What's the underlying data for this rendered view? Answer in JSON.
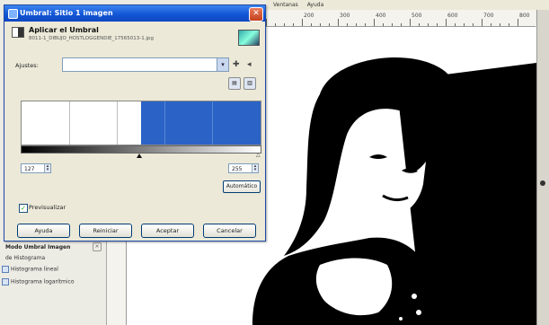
{
  "dialog": {
    "title": "Umbral: Sitio 1 imagen",
    "header_title": "Aplicar el Umbral",
    "header_file": "8011-1_DIBUJO_HOSTLOGGENDIE_17565013-1.jpg",
    "presets_label": "Ajustes:",
    "presets_value": "",
    "low_value": "127",
    "high_value": "255",
    "auto_label": "Automático",
    "preview_label": "Previsualizar",
    "preview_checked": true,
    "buttons": {
      "help": "Ayuda",
      "reset": "Reiniciar",
      "ok": "Aceptar",
      "cancel": "Cancelar"
    },
    "colors": {
      "titlebar": "#1356d6",
      "histogram_selection": "#2b62c6"
    }
  },
  "background": {
    "menu_items": [
      "Ventanas",
      "Ayuda"
    ],
    "ruler_labels": [
      "200",
      "300",
      "400",
      "500",
      "600",
      "700",
      "800"
    ]
  },
  "dock": {
    "title": "Modo Umbral Imagen",
    "subtitle": "de Histograma",
    "items": [
      "Histograma lineal",
      "Histograma logarítmico"
    ]
  }
}
